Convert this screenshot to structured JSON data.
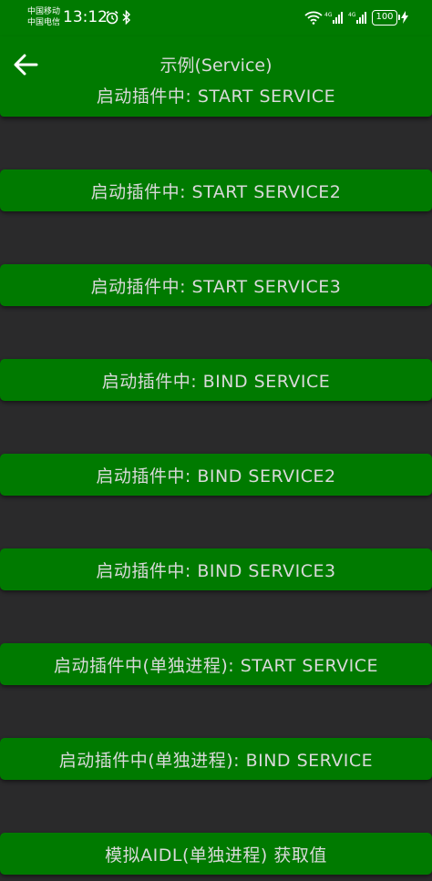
{
  "status_bar": {
    "carrier_1": "中国移动",
    "carrier_2": "中国电信",
    "time": "13:12",
    "battery": "100"
  },
  "app_bar": {
    "title": "示例(Service)",
    "first_button_label": "启动插件中: START SERVICE"
  },
  "buttons": [
    "启动插件中: START SERVICE2",
    "启动插件中: START SERVICE3",
    "启动插件中: BIND SERVICE",
    "启动插件中: BIND SERVICE2",
    "启动插件中: BIND SERVICE3",
    "启动插件中(单独进程): START SERVICE",
    "启动插件中(单独进程): BIND SERVICE",
    "模拟AIDL(单独进程) 获取值"
  ],
  "colors": {
    "accent": "#007a00",
    "background": "#2a2a2b",
    "text": "#d9d9d9"
  },
  "icons": [
    "back-arrow-icon",
    "alarm-icon",
    "bluetooth-icon",
    "wifi-icon",
    "signal-icon",
    "charging-icon"
  ]
}
